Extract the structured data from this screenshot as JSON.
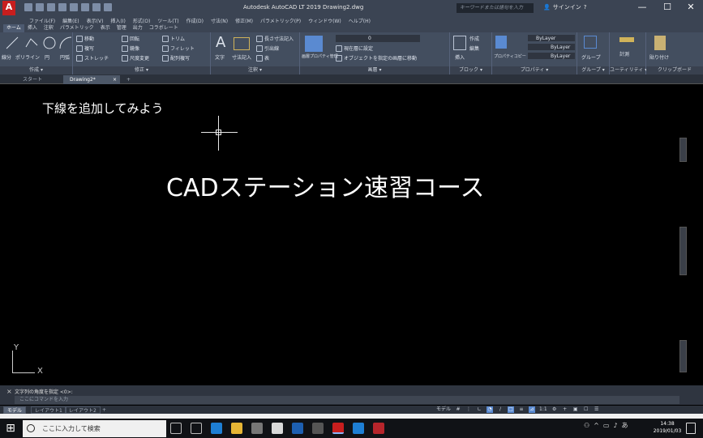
{
  "window": {
    "title": "Autodesk AutoCAD LT 2019    Drawing2.dwg",
    "app_logo": "A",
    "search_placeholder": "キーワードまたは語句を入力",
    "signin": "サインイン",
    "min": "—",
    "max": "☐",
    "close": "✕"
  },
  "menubar": [
    "ファイル(F)",
    "編集(E)",
    "表示(V)",
    "挿入(I)",
    "形式(O)",
    "ツール(T)",
    "作成(D)",
    "寸法(N)",
    "修正(M)",
    "パラメトリック(P)",
    "ウィンドウ(W)",
    "ヘルプ(H)"
  ],
  "ribbon_tabs": [
    "ホーム",
    "挿入",
    "注釈",
    "パラメトリック",
    "表示",
    "管理",
    "出力",
    "コラボレート"
  ],
  "ribbon": {
    "draw": {
      "title": "作成 ▾",
      "line": "線分",
      "polyline": "ポリライン",
      "circle": "円",
      "arc": "円弧"
    },
    "modify": {
      "title": "修正 ▾",
      "move": "移動",
      "rotate": "回転",
      "trim": "トリム",
      "copy": "複写",
      "mirror": "鏡像",
      "fillet": "フィレット",
      "stretch": "ストレッチ",
      "scale": "尺度変更",
      "array": "配列複写"
    },
    "annotation": {
      "title": "注釈 ▾",
      "text": "文字",
      "dimension": "寸法記入",
      "linear": "長さ寸法記入",
      "leader": "引出線",
      "table": "表"
    },
    "layers": {
      "title": "画層 ▾",
      "properties": "画層プロパティ管理",
      "layer_value": "0",
      "set_current": "現在層に設定",
      "match": "オブジェクトを指定の画層に移動"
    },
    "block": {
      "title": "ブロック ▾",
      "insert": "挿入",
      "create": "作成",
      "edit": "編集"
    },
    "properties": {
      "title": "プロパティ ▾",
      "match": "プロパティコピー",
      "bylayer1": "ByLayer",
      "bylayer2": "ByLayer",
      "bylayer3": "ByLayer"
    },
    "groups": {
      "title": "グループ ▾",
      "group": "グループ"
    },
    "utilities": {
      "title": "ユーティリティ ▾",
      "measure": "計測"
    },
    "clipboard": {
      "title": "クリップボード",
      "paste": "貼り付け"
    }
  },
  "doc_tabs": {
    "start": "スタート",
    "drawing": "Drawing2*",
    "close": "×",
    "add": "+"
  },
  "canvas": {
    "note": "下線を追加してみよう",
    "main_text": "CADステーション速習コース",
    "ucs_x": "X",
    "ucs_y": "Y"
  },
  "command": {
    "history": "文字列の角度を指定 <0>:",
    "prompt": "ここにコマンドを入力"
  },
  "layout_tabs": [
    "モデル",
    "レイアウト1",
    "レイアウト2",
    "+"
  ],
  "status": {
    "model": "モデル",
    "scale": "1:1"
  },
  "taskbar": {
    "search": "ここに入力して検索",
    "time": "14:38",
    "date": "2019/01/03",
    "ime": "あ"
  },
  "colors": {
    "accent": "#5a8ad1",
    "app_red": "#c81e1e",
    "background": "#000000"
  }
}
